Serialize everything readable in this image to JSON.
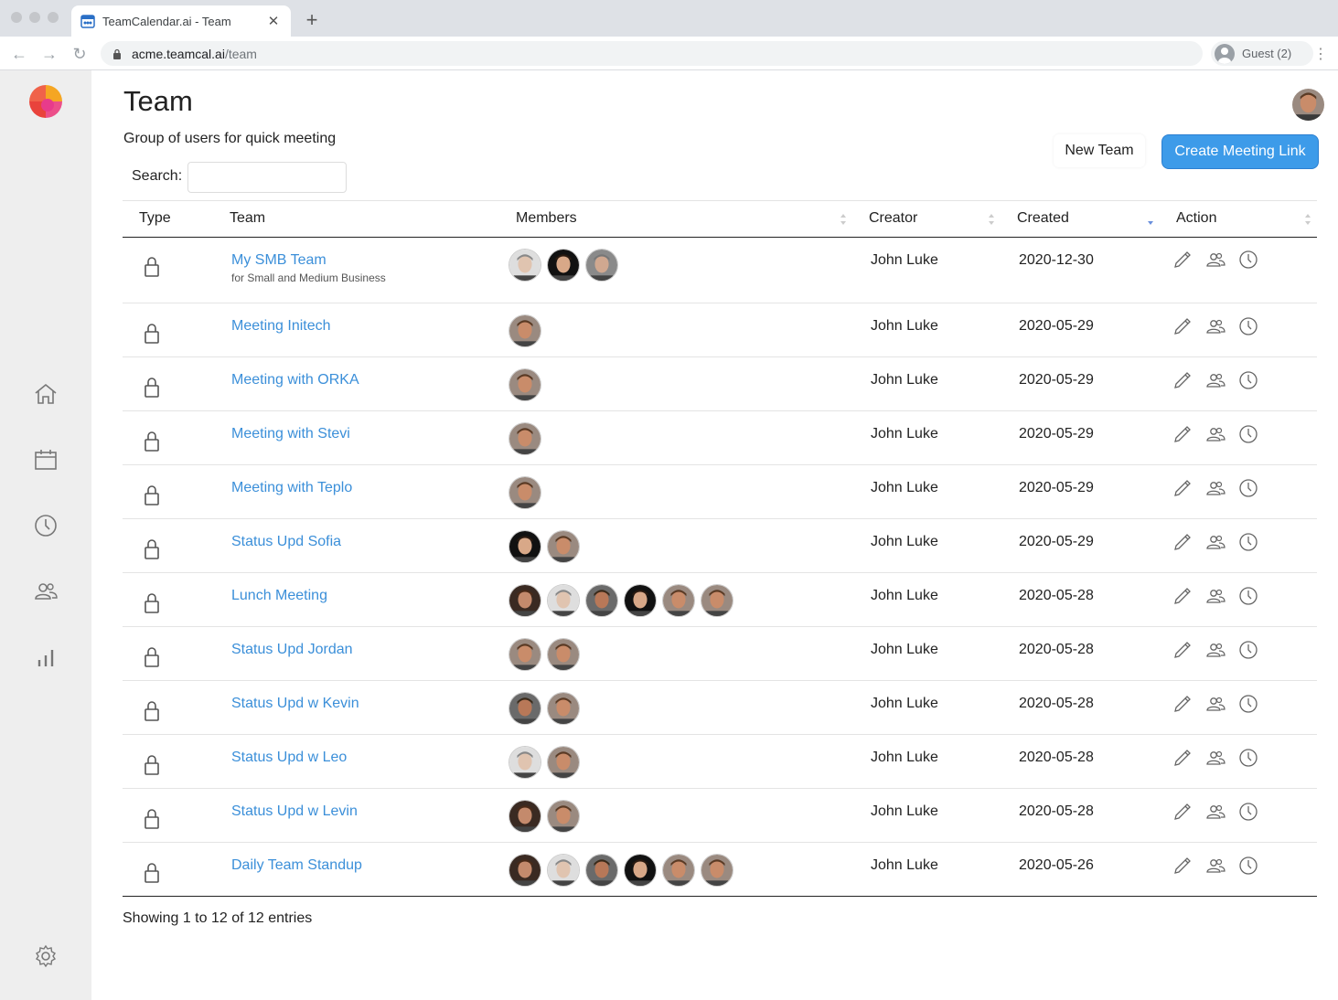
{
  "browser": {
    "tab_title": "TeamCalendar.ai - Team",
    "url_host": "acme.teamcal.ai",
    "url_path": "/team",
    "guest_label": "Guest (2)"
  },
  "page": {
    "title": "Team",
    "subtitle": "Group of users for quick meeting",
    "search_label": "Search:",
    "search_value": "",
    "new_team_label": "New Team",
    "create_link_label": "Create Meeting Link",
    "footer": "Showing 1 to 12 of 12 entries"
  },
  "columns": {
    "type": "Type",
    "team": "Team",
    "members": "Members",
    "creator": "Creator",
    "created": "Created",
    "action": "Action"
  },
  "colors": {
    "link": "#3b8fd9",
    "primary_button": "#3d9be9",
    "sidebar_bg": "#eeeeee"
  },
  "avatar_palette": {
    "a": {
      "skin": "#c98c6a",
      "hair": "#5a3a24",
      "bg": "#9a8a80"
    },
    "b": {
      "skin": "#e0c4b0",
      "hair": "#888888",
      "bg": "#dedede"
    },
    "c": {
      "skin": "#d8a888",
      "hair": "#2a1a10",
      "bg": "#111111"
    },
    "d": {
      "skin": "#d0a890",
      "hair": "#777777",
      "bg": "#8a8a8a"
    },
    "e": {
      "skin": "#b87858",
      "hair": "#3a2a1a",
      "bg": "#6a6a6a"
    },
    "f": {
      "skin": "#c48a6c",
      "hair": "#4a2a18",
      "bg": "#3a2a22"
    }
  },
  "rows": [
    {
      "name": "My SMB Team",
      "sub": "for Small and Medium Business",
      "members": [
        "b",
        "c",
        "d"
      ],
      "creator": "John Luke",
      "created": "2020-12-30"
    },
    {
      "name": "Meeting Initech",
      "sub": "",
      "members": [
        "a"
      ],
      "creator": "John Luke",
      "created": "2020-05-29"
    },
    {
      "name": "Meeting with ORKA",
      "sub": "",
      "members": [
        "a"
      ],
      "creator": "John Luke",
      "created": "2020-05-29"
    },
    {
      "name": "Meeting with Stevi",
      "sub": "",
      "members": [
        "a"
      ],
      "creator": "John Luke",
      "created": "2020-05-29"
    },
    {
      "name": "Meeting with Teplo",
      "sub": "",
      "members": [
        "a"
      ],
      "creator": "John Luke",
      "created": "2020-05-29"
    },
    {
      "name": "Status Upd Sofia",
      "sub": "",
      "members": [
        "c",
        "a"
      ],
      "creator": "John Luke",
      "created": "2020-05-29"
    },
    {
      "name": "Lunch Meeting",
      "sub": "",
      "members": [
        "f",
        "b",
        "e",
        "c",
        "a",
        "a"
      ],
      "creator": "John Luke",
      "created": "2020-05-28"
    },
    {
      "name": "Status Upd Jordan",
      "sub": "",
      "members": [
        "a",
        "a"
      ],
      "creator": "John Luke",
      "created": "2020-05-28"
    },
    {
      "name": "Status Upd w Kevin",
      "sub": "",
      "members": [
        "e",
        "a"
      ],
      "creator": "John Luke",
      "created": "2020-05-28"
    },
    {
      "name": "Status Upd w Leo",
      "sub": "",
      "members": [
        "b",
        "a"
      ],
      "creator": "John Luke",
      "created": "2020-05-28"
    },
    {
      "name": "Status Upd w Levin",
      "sub": "",
      "members": [
        "f",
        "a"
      ],
      "creator": "John Luke",
      "created": "2020-05-28"
    },
    {
      "name": "Daily Team Standup",
      "sub": "",
      "members": [
        "f",
        "b",
        "e",
        "c",
        "a",
        "a"
      ],
      "creator": "John Luke",
      "created": "2020-05-26"
    }
  ]
}
